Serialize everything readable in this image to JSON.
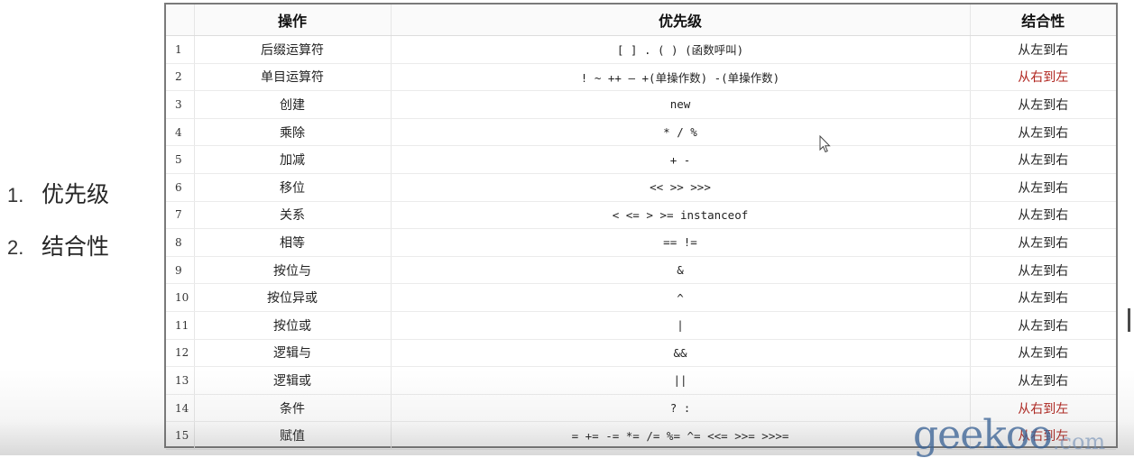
{
  "slide": {
    "points": [
      {
        "number": "1.",
        "text": "优先级"
      },
      {
        "number": "2.",
        "text": "结合性"
      }
    ]
  },
  "table": {
    "headers": [
      "",
      "操作",
      "优先级",
      "结合性"
    ],
    "rows": [
      {
        "index": "1",
        "operation": "后缀运算符",
        "operators": "[ ] . ( ) (函数呼叫)",
        "associativity": "从左到右",
        "rtl": false
      },
      {
        "index": "2",
        "operation": "单目运算符",
        "operators": "! ~ ++ — +(单操作数) -(单操作数)",
        "associativity": "从右到左",
        "rtl": true
      },
      {
        "index": "3",
        "operation": "创建",
        "operators": "new",
        "associativity": "从左到右",
        "rtl": false
      },
      {
        "index": "4",
        "operation": "乘除",
        "operators": "* / %",
        "associativity": "从左到右",
        "rtl": false
      },
      {
        "index": "5",
        "operation": "加减",
        "operators": "+ -",
        "associativity": "从左到右",
        "rtl": false
      },
      {
        "index": "6",
        "operation": "移位",
        "operators": "<< >> >>>",
        "associativity": "从左到右",
        "rtl": false
      },
      {
        "index": "7",
        "operation": "关系",
        "operators": "< <= > >= instanceof",
        "associativity": "从左到右",
        "rtl": false
      },
      {
        "index": "8",
        "operation": "相等",
        "operators": "== !=",
        "associativity": "从左到右",
        "rtl": false
      },
      {
        "index": "9",
        "operation": "按位与",
        "operators": "&",
        "associativity": "从左到右",
        "rtl": false
      },
      {
        "index": "10",
        "operation": "按位异或",
        "operators": "^",
        "associativity": "从左到右",
        "rtl": false
      },
      {
        "index": "11",
        "operation": "按位或",
        "operators": "|",
        "associativity": "从左到右",
        "rtl": false
      },
      {
        "index": "12",
        "operation": "逻辑与",
        "operators": "&&",
        "associativity": "从左到右",
        "rtl": false
      },
      {
        "index": "13",
        "operation": "逻辑或",
        "operators": "||",
        "associativity": "从左到右",
        "rtl": false
      },
      {
        "index": "14",
        "operation": "条件",
        "operators": "? :",
        "associativity": "从右到左",
        "rtl": true
      },
      {
        "index": "15",
        "operation": "赋值",
        "operators": "= += -= *= /= %= ^= <<= >>= >>>=",
        "associativity": "从右到左",
        "rtl": true
      }
    ]
  },
  "watermark": {
    "main": "geekoo",
    "suffix": ".com"
  },
  "icons": {
    "cursor": "mouse-pointer-icon"
  },
  "colors": {
    "right_to_left": "#b0241e",
    "table_border": "#7a7a7a"
  }
}
